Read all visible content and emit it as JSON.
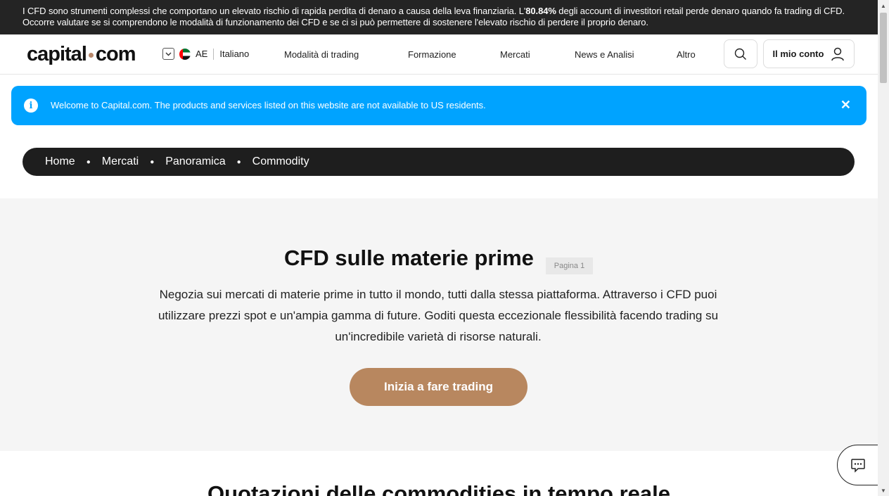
{
  "risk_warning": {
    "before": "I CFD sono strumenti complessi che comportano un elevato rischio di rapida perdita di denaro a causa della leva finanziaria. L'",
    "percent": "80.84%",
    "after": " degli account di investitori retail perde denaro quando fa trading di CFD. Occorre valutare se si comprendono le modalità di funzionamento dei CFD e se ci si può permettere di sostenere l'elevato rischio di perdere il proprio denaro."
  },
  "header": {
    "logo_left": "capital",
    "logo_right": "com",
    "region_code": "AE",
    "language": "Italiano",
    "nav": [
      "Modalità di trading",
      "Formazione",
      "Mercati",
      "News e Analisi",
      "Altro"
    ],
    "account_label": "Il mio conto",
    "icons": {
      "search": "search-icon",
      "account": "user-icon",
      "region": "chevron-down-icon"
    }
  },
  "notice": {
    "message": "Welcome to Capital.com. The products and services listed on this website are not available to US residents.",
    "info_glyph": "i",
    "close_glyph": "✕"
  },
  "breadcrumb": [
    "Home",
    "Mercati",
    "Panoramica",
    "Commodity"
  ],
  "hero": {
    "title": "CFD sulle materie prime",
    "page_badge": "Pagina 1",
    "description": "Negozia sui mercati di materie prime in tutto il mondo, tutti dalla stessa piattaforma. Attraverso i CFD puoi utilizzare prezzi spot e un'ampia gamma di future. Goditi questa eccezionale flessibilità facendo trading su un'incredibile varietà di risorse naturali.",
    "cta_label": "Inizia a fare trading"
  },
  "next_section_title": "Quotazioni delle commodities in tempo reale",
  "colors": {
    "notice_bg": "#00a3ff",
    "cta_bg": "#b8875f",
    "dark": "#1e1e1e",
    "hero_bg": "#f5f5f5"
  }
}
